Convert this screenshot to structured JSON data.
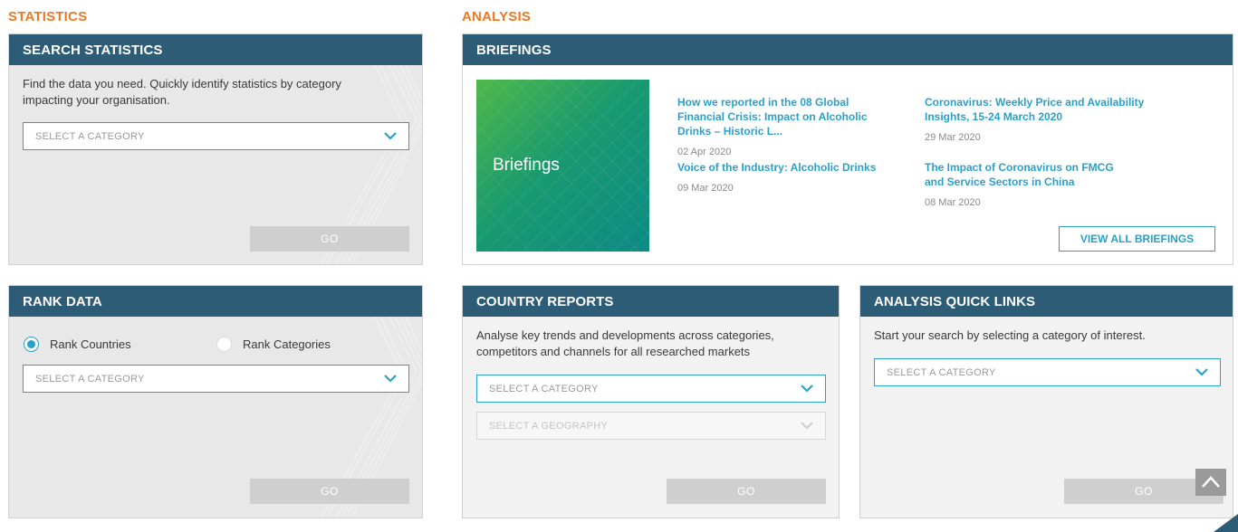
{
  "sections": {
    "statistics": "STATISTICS",
    "analysis": "ANALYSIS"
  },
  "search_statistics": {
    "title": "SEARCH STATISTICS",
    "description": "Find the data you need. Quickly identify statistics by category impacting your organisation.",
    "select_placeholder": "SELECT A CATEGORY",
    "go_label": "GO"
  },
  "rank_data": {
    "title": "RANK DATA",
    "radio_countries": "Rank Countries",
    "radio_categories": "Rank Categories",
    "selected": "Rank Countries",
    "select_placeholder": "SELECT A CATEGORY",
    "go_label": "GO"
  },
  "briefings": {
    "title": "BRIEFINGS",
    "image_label": "Briefings",
    "items": [
      {
        "title": "How we reported in the 08 Global Financial Crisis: Impact on Alcoholic Drinks – Historic L...",
        "date": "02 Apr 2020"
      },
      {
        "title": "Voice of the Industry: Alcoholic Drinks",
        "date": "09 Mar 2020"
      },
      {
        "title": "Coronavirus: Weekly Price and Availability Insights, 15-24 March 2020",
        "date": "29 Mar 2020"
      },
      {
        "title": "The Impact of Coronavirus on FMCG and Service Sectors in China",
        "date": "08 Mar 2020"
      }
    ],
    "view_all_label": "VIEW ALL BRIEFINGS"
  },
  "country_reports": {
    "title": "COUNTRY REPORTS",
    "description": "Analyse key trends and developments across categories, competitors and channels for all researched markets",
    "category_placeholder": "SELECT A CATEGORY",
    "geography_placeholder": "SELECT A GEOGRAPHY",
    "go_label": "GO"
  },
  "analysis_quick_links": {
    "title": "ANALYSIS QUICK LINKS",
    "description": "Start your search by selecting a category of interest.",
    "select_placeholder": "SELECT A CATEGORY",
    "go_label": "GO"
  },
  "icons": {
    "scroll_top": "chevron-up-icon",
    "dropdown": "chevron-down-icon"
  },
  "colors": {
    "accent_orange": "#ee7722",
    "header_blue": "#2d5d76",
    "link_blue": "#2aa1c8"
  }
}
